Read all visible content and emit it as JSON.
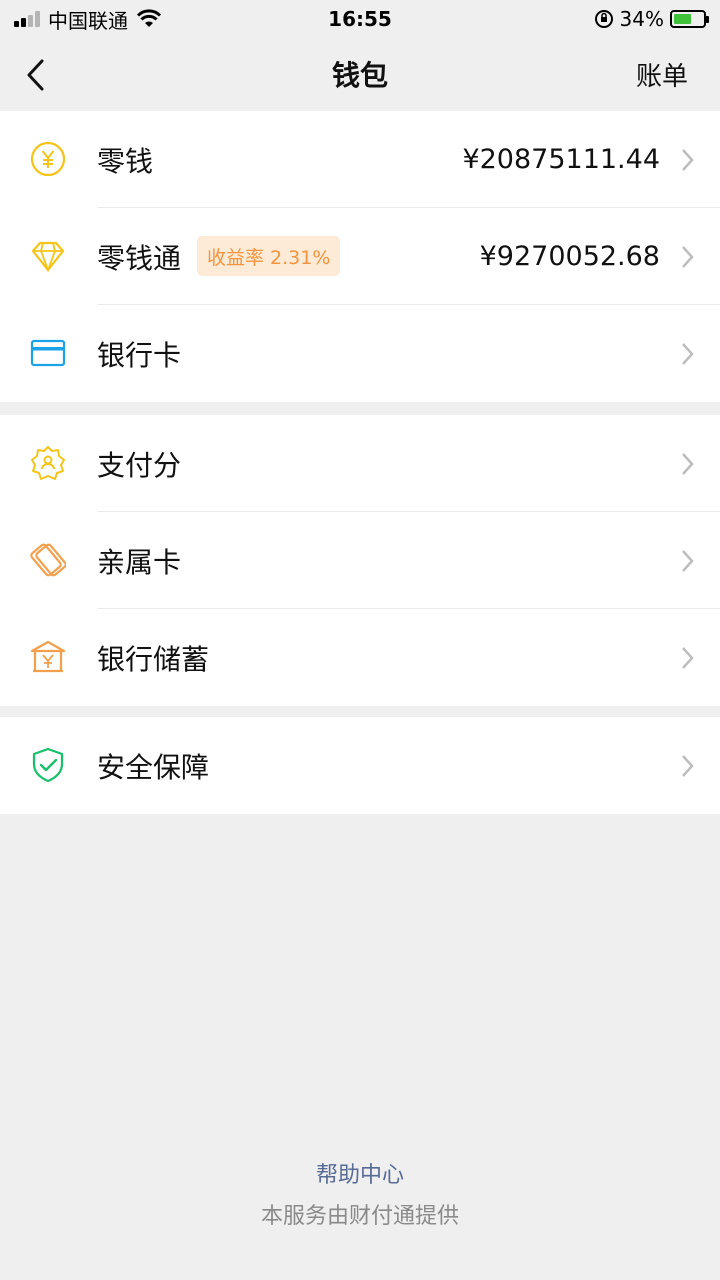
{
  "status_bar": {
    "carrier": "中国联通",
    "time": "16:55",
    "battery": "34%"
  },
  "header": {
    "title": "钱包",
    "bill": "账单"
  },
  "groups": [
    {
      "items": [
        {
          "label": "零钱",
          "amount": "¥20875111.44",
          "icon": "yuan-coin-icon"
        },
        {
          "label": "零钱通",
          "badge": "收益率 2.31%",
          "amount": "¥9270052.68",
          "icon": "diamond-icon"
        },
        {
          "label": "银行卡",
          "icon": "bank-card-icon"
        }
      ]
    },
    {
      "items": [
        {
          "label": "支付分",
          "icon": "payscore-badge-icon"
        },
        {
          "label": "亲属卡",
          "icon": "family-card-icon"
        },
        {
          "label": "银行储蓄",
          "icon": "bank-savings-icon"
        }
      ]
    },
    {
      "items": [
        {
          "label": "安全保障",
          "icon": "shield-check-icon"
        }
      ]
    }
  ],
  "footer": {
    "help": "帮助中心",
    "provider": "本服务由财付通提供"
  },
  "colors": {
    "background": "#efefef",
    "gold": "#f5c418",
    "orange": "#f2a04d",
    "blue": "#1aa3e8",
    "green": "#17c06a",
    "link": "#586b95"
  }
}
